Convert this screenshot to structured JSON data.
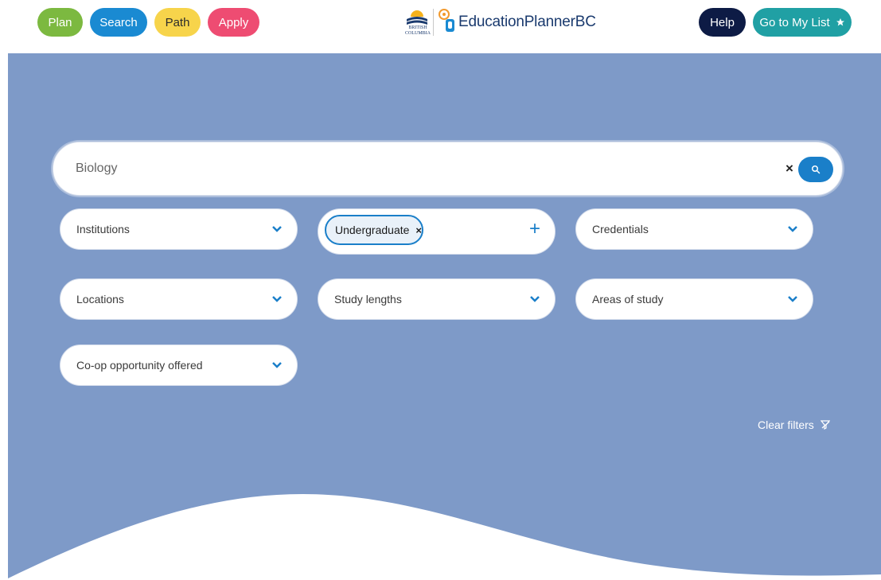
{
  "nav": {
    "plan": "Plan",
    "search": "Search",
    "path": "Path",
    "apply": "Apply"
  },
  "logo": {
    "bc_line1": "BRITISH",
    "bc_line2": "COLUMBIA",
    "brand": "EducationPlannerBC"
  },
  "header_actions": {
    "help": "Help",
    "my_list": "Go to My List"
  },
  "search": {
    "value": "Biology",
    "clear_glyph": "×"
  },
  "filters": {
    "institutions": "Institutions",
    "level_chip": "Undergraduate",
    "level_chip_remove": "×",
    "level_add": "+",
    "credentials": "Credentials",
    "locations": "Locations",
    "study_lengths": "Study lengths",
    "areas_of_study": "Areas of study",
    "coop": "Co-op opportunity offered"
  },
  "clear_filters": "Clear filters",
  "colors": {
    "plan": "#7cb940",
    "search": "#1a8ad2",
    "path": "#f7d44b",
    "apply": "#ee4c72",
    "help": "#0d1b45",
    "my_list": "#20a0a4",
    "hero": "#7e9ac8",
    "accent": "#1a7fc9"
  },
  "icons": [
    "star-icon",
    "search-icon",
    "chevron-down-icon",
    "plus-icon",
    "clear-filter-icon",
    "bc-sun-logo",
    "ep-logo"
  ]
}
